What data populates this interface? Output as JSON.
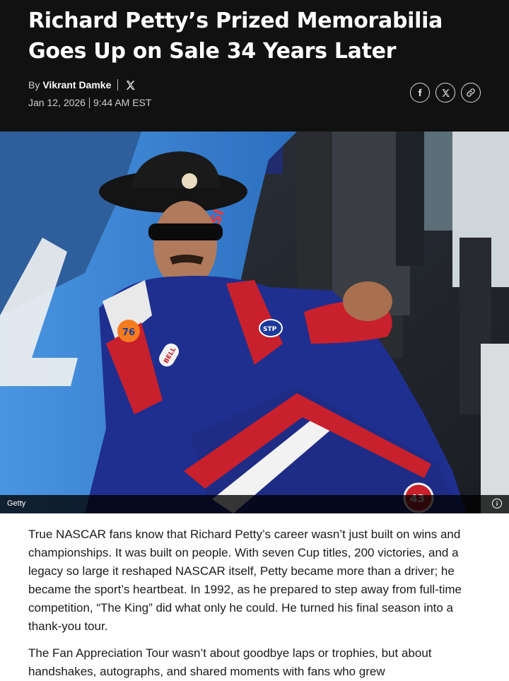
{
  "article": {
    "headline": "Richard Petty’s Prized Memorabilia Goes Up on Sale 34 Years Later",
    "byline_prefix": "By",
    "author": "Vikrant Damke",
    "date": "Jan 12, 2026",
    "time": "9:44 AM EST"
  },
  "share": {
    "icons": [
      "facebook-icon",
      "x-icon",
      "link-icon"
    ]
  },
  "hero_image": {
    "credit": "Getty",
    "info_icon": "info-icon",
    "text_in_image": {
      "car_sponsor": "EPSI",
      "suit_logo": "76",
      "suit_badge": "STP",
      "bell_patch": "BELL",
      "car_number": "43"
    }
  },
  "body": {
    "paragraphs": [
      "True NASCAR fans know that Richard Petty’s career wasn’t just built on wins and championships. It was built on people. With seven Cup titles, 200 victories, and a legacy so large it reshaped NASCAR itself, Petty became more than a driver; he became the sport’s heartbeat. In 1992, as he prepared to step away from full-time competition, “The King” did what only he could. He turned his final season into a thank-you tour.",
      "The Fan Appreciation Tour wasn’t about goodbye laps or trophies, but about handshakes, autographs, and shared moments with fans who grew"
    ]
  },
  "colors": {
    "header_bg": "#111111",
    "car_blue": "#3d8ad6",
    "suit_navy": "#1f2f8f",
    "suit_red": "#c8202c"
  }
}
